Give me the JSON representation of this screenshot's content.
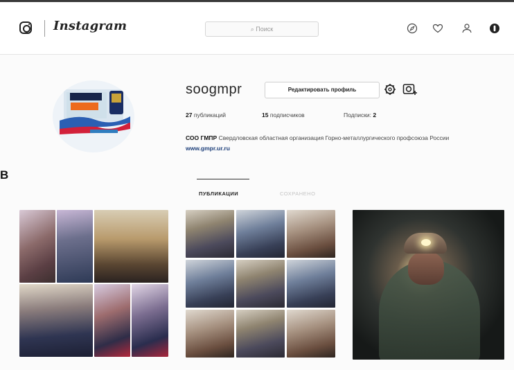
{
  "header": {
    "app_name": "Instagram",
    "search_placeholder": "⌕ Поиск",
    "nav_icons": [
      "compass-icon",
      "heart-icon",
      "profile-icon",
      "notifications-icon"
    ]
  },
  "profile": {
    "username": "soogmpr",
    "edit_button": "Редактировать профиль",
    "stats": {
      "posts_count": "27",
      "posts_label": "публикаций",
      "followers_count": "15",
      "followers_label": "подписчиков",
      "following_label": "Подписки:",
      "following_count": "2"
    },
    "bio": {
      "name": "СОО ГМПР",
      "text": " Свердловская областная организация Горно-металлургического профсоюза России ",
      "link": "www.gmpr.ur.ru"
    }
  },
  "tabs": {
    "posts": "ПУБЛИКАЦИИ",
    "saved": "СОХРАНЕНО"
  },
  "side_label": "В",
  "colors": {
    "link": "#1d3f7a",
    "border": "#dbdbdb",
    "text": "#262626"
  }
}
